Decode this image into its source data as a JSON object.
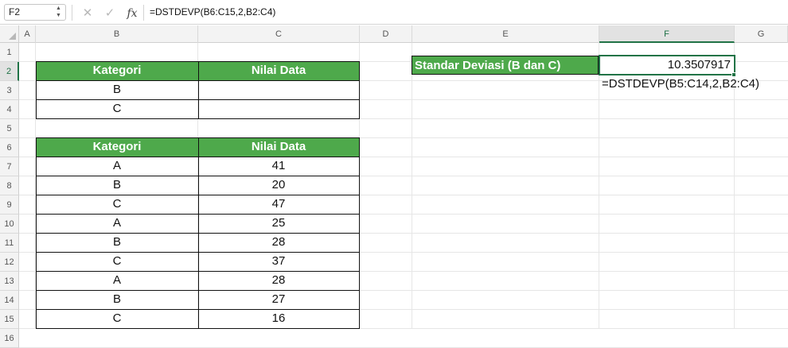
{
  "formula_bar": {
    "name_box": "F2",
    "cancel_icon": "✕",
    "enter_icon": "✓",
    "fx_label": "fx",
    "formula": "=DSTDEVP(B6:C15,2,B2:C4)"
  },
  "columns": [
    "A",
    "B",
    "C",
    "D",
    "E",
    "F",
    "G"
  ],
  "selected_column": "F",
  "rows": [
    "1",
    "2",
    "3",
    "4",
    "5",
    "6",
    "7",
    "8",
    "9",
    "10",
    "11",
    "12",
    "13",
    "14",
    "15",
    "16"
  ],
  "selected_row": "2",
  "criteria_table": {
    "headers": [
      "Kategori",
      "Nilai Data"
    ],
    "rows": [
      [
        "B",
        ""
      ],
      [
        "C",
        ""
      ]
    ]
  },
  "data_table": {
    "headers": [
      "Kategori",
      "Nilai Data"
    ],
    "rows": [
      [
        "A",
        "41"
      ],
      [
        "B",
        "20"
      ],
      [
        "C",
        "47"
      ],
      [
        "A",
        "25"
      ],
      [
        "B",
        "28"
      ],
      [
        "C",
        "37"
      ],
      [
        "A",
        "28"
      ],
      [
        "B",
        "27"
      ],
      [
        "C",
        "16"
      ]
    ]
  },
  "result": {
    "label": "Standar Deviasi (B dan C)",
    "value": "10.3507917",
    "formula_note": "=DSTDEVP(B5:C14,2,B2:C4)"
  },
  "colors": {
    "header_green": "#4ea94b",
    "selection_green": "#217346"
  }
}
